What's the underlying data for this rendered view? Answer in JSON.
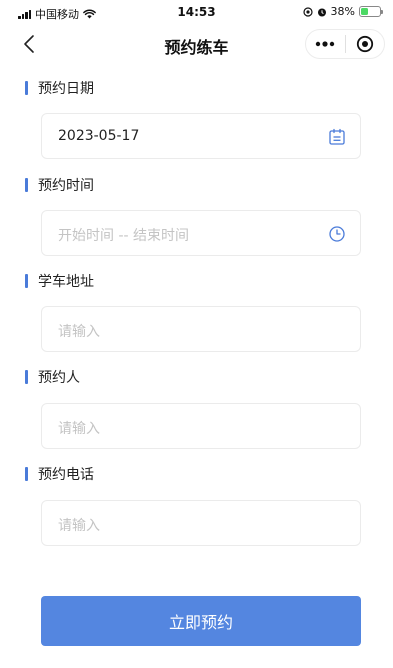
{
  "status_bar": {
    "carrier": "中国移动",
    "time": "14:53",
    "battery_percent": "38%",
    "battery_level": 0.38,
    "icons": [
      "signal-icon",
      "wifi-icon",
      "location-icon",
      "alarm-icon",
      "battery-icon"
    ]
  },
  "nav": {
    "title": "预约练车",
    "back_icon": "chevron-left-icon",
    "more_icon": "more-icon",
    "close_icon": "target-close-icon"
  },
  "form": {
    "date": {
      "label": "预约日期",
      "value": "2023-05-17",
      "icon": "calendar-icon"
    },
    "time": {
      "label": "预约时间",
      "placeholder": "开始时间 -- 结束时间",
      "icon": "clock-icon"
    },
    "address": {
      "label": "学车地址",
      "placeholder": "请输入"
    },
    "person": {
      "label": "预约人",
      "placeholder": "请输入"
    },
    "phone": {
      "label": "预约电话",
      "placeholder": "请输入"
    }
  },
  "submit_label": "立即预约",
  "colors": {
    "accent": "#4a7bd9",
    "button": "#5486e0",
    "placeholder": "#c4c4c4",
    "border": "#ebebeb"
  }
}
